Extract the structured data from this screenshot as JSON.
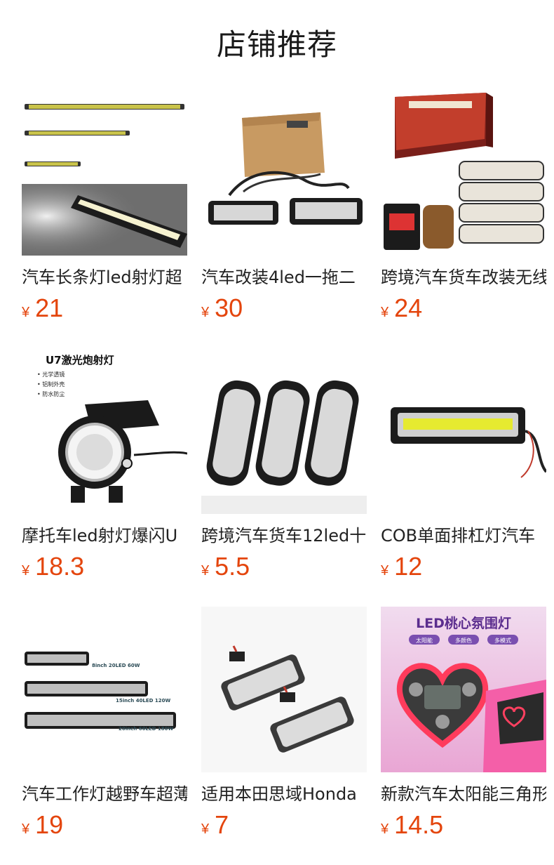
{
  "header": {
    "title": "店铺推荐"
  },
  "products": [
    {
      "title": "汽车长条灯led射灯超",
      "currency": "¥",
      "price": "21",
      "image_icon": "led-light-bar-image"
    },
    {
      "title": "汽车改装4led一拖二",
      "currency": "¥",
      "price": "30",
      "image_icon": "strobe-light-kit-image"
    },
    {
      "title": "跨境汽车货车改装无线",
      "currency": "¥",
      "price": "24",
      "image_icon": "boxed-strobe-lights-image"
    },
    {
      "title": "摩托车led射灯爆闪U",
      "currency": "¥",
      "price": "18.3",
      "image_icon": "motorcycle-spotlight-image"
    },
    {
      "title": "跨境汽车货车12led十",
      "currency": "¥",
      "price": "5.5",
      "image_icon": "12-led-strobe-image"
    },
    {
      "title": "COB单面排杠灯汽车",
      "currency": "¥",
      "price": "12",
      "image_icon": "cob-light-bar-image"
    },
    {
      "title": "汽车工作灯越野车超薄",
      "currency": "¥",
      "price": "19",
      "image_icon": "work-light-bars-image"
    },
    {
      "title": "适用本田思域Honda",
      "currency": "¥",
      "price": "7",
      "image_icon": "license-plate-light-image"
    },
    {
      "title": "新款汽车太阳能三角形",
      "currency": "¥",
      "price": "14.5",
      "image_icon": "heart-ambient-light-image"
    }
  ],
  "image_text": {
    "u7_title": "U7激光炮射灯",
    "u7_bullets": [
      "• 光学透镜",
      "• 铝制外壳",
      "• 防水防尘"
    ],
    "work_labels": [
      "8inch 20LED 60W",
      "15inch 40LED 120W",
      "20inch 60LED 180W"
    ],
    "heart_title": "LED桃心氛围灯",
    "heart_tags": [
      "太阳能",
      "多颜色",
      "多模式"
    ]
  }
}
